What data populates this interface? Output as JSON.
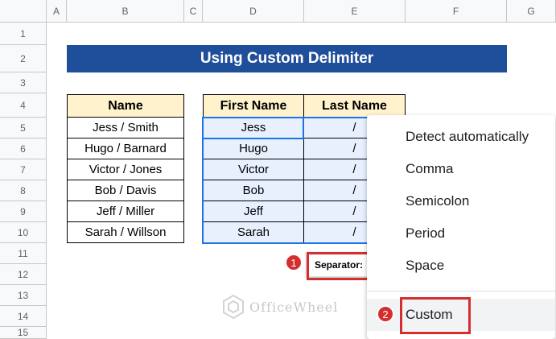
{
  "columns": [
    "A",
    "B",
    "C",
    "D",
    "E",
    "F",
    "G"
  ],
  "rows": [
    "1",
    "2",
    "3",
    "4",
    "5",
    "6",
    "7",
    "8",
    "9",
    "10",
    "11",
    "12",
    "13",
    "14",
    "15"
  ],
  "title": "Using Custom Delimiter",
  "table1": {
    "header": "Name",
    "values": [
      "Jess / Smith",
      "Hugo / Barnard",
      "Victor / Jones",
      "Bob / Davis",
      "Jeff / Miller",
      "Sarah / Willson"
    ]
  },
  "table2": {
    "header_first": "First Name",
    "header_last": "Last Name",
    "first": [
      "Jess",
      "Hugo",
      "Victor",
      "Bob",
      "Jeff",
      "Sarah"
    ],
    "last": [
      "/",
      "/",
      "/",
      "/",
      "/",
      "/"
    ]
  },
  "separator": {
    "label": "Separator:"
  },
  "menu": {
    "items": [
      "Detect automatically",
      "Comma",
      "Semicolon",
      "Period",
      "Space"
    ],
    "custom": "Custom"
  },
  "badges": [
    "1",
    "2"
  ],
  "watermark": "OfficeWheel",
  "colors": {
    "title_bg": "#1f4e9a",
    "header_bg": "#fff2cc",
    "split_bg": "#e8f0fe",
    "highlight": "#d32f2f"
  }
}
